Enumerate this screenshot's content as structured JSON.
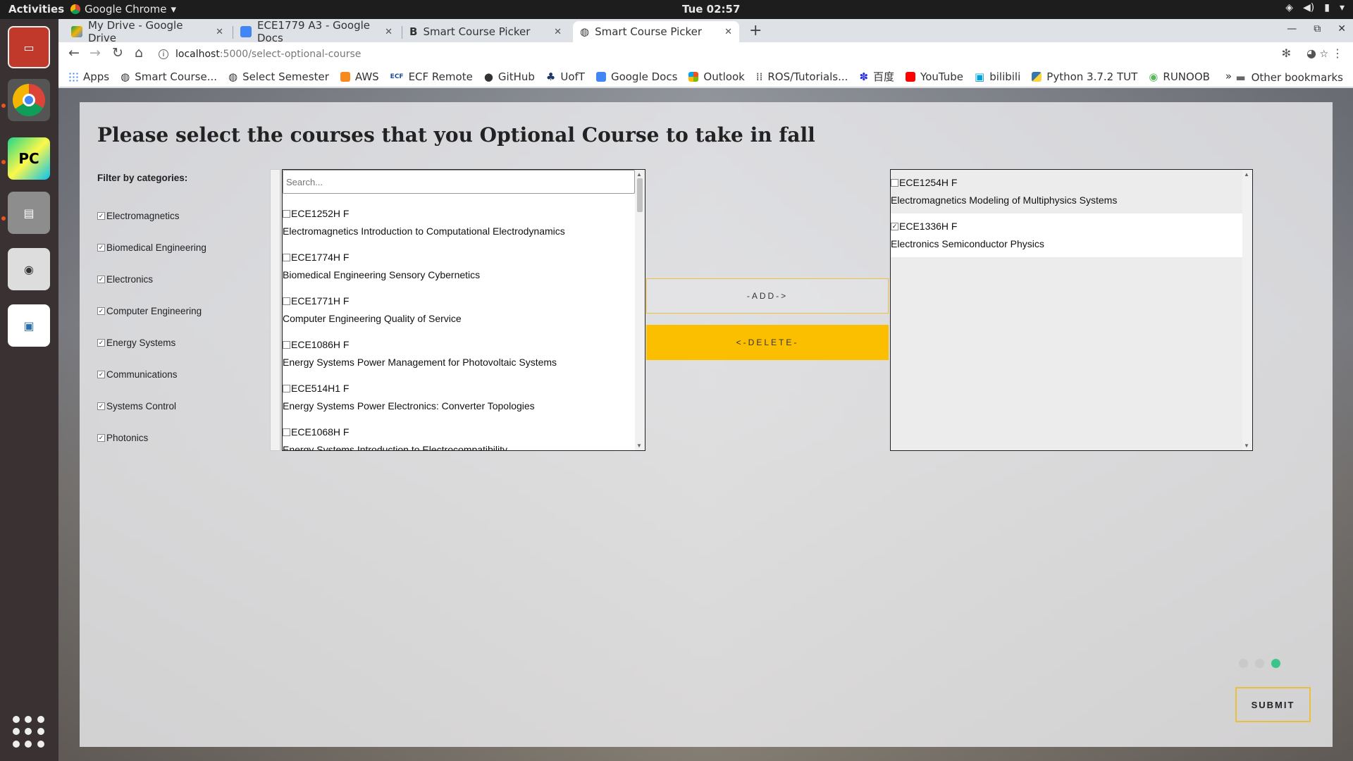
{
  "system": {
    "activities": "Activities",
    "app_name": "Google Chrome",
    "clock": "Tue 02:57"
  },
  "tabs": [
    {
      "title": "My Drive - Google Drive",
      "icon": "google-drive-icon",
      "active": false
    },
    {
      "title": "ECE1779 A3 - Google Docs",
      "icon": "google-docs-icon",
      "active": false
    },
    {
      "title": "Smart Course Picker",
      "icon": "bold-b-icon",
      "active": false
    },
    {
      "title": "Smart Course Picker",
      "icon": "globe-icon",
      "active": true
    }
  ],
  "omnibox": {
    "host": "localhost",
    "path": ":5000/select-optional-course"
  },
  "bookmarks": {
    "items": [
      "Apps",
      "Smart Course...",
      "Select Semester",
      "AWS",
      "ECF Remote",
      "GitHub",
      "UofT",
      "Google Docs",
      "Outlook",
      "ROS/Tutorials...",
      "百度",
      "YouTube",
      "bilibili",
      "Python 3.7.2 TUT",
      "RUNOOB"
    ],
    "more": "»",
    "other": "Other bookmarks"
  },
  "page": {
    "title": "Please select the courses that you Optional Course to take in fall",
    "filter_label": "Filter by categories:",
    "categories": [
      {
        "label": "Electromagnetics",
        "checked": true
      },
      {
        "label": "Biomedical Engineering",
        "checked": true
      },
      {
        "label": "Electronics",
        "checked": true
      },
      {
        "label": "Computer Engineering",
        "checked": true
      },
      {
        "label": "Energy Systems",
        "checked": true
      },
      {
        "label": "Communications",
        "checked": true
      },
      {
        "label": "Systems Control",
        "checked": true
      },
      {
        "label": "Photonics",
        "checked": true
      }
    ],
    "search_placeholder": "Search...",
    "available": [
      {
        "code": "ECE1252H F",
        "title": "Electromagnetics Introduction to Computational Electrodynamics"
      },
      {
        "code": "ECE1774H F",
        "title": "Biomedical Engineering Sensory Cybernetics"
      },
      {
        "code": "ECE1771H F",
        "title": "Computer Engineering Quality of Service"
      },
      {
        "code": "ECE1086H F",
        "title": "Energy Systems Power Management for Photovoltaic Systems"
      },
      {
        "code": "ECE514H1 F",
        "title": "Energy Systems Power Electronics: Converter Topologies"
      },
      {
        "code": "ECE1068H F",
        "title": "Energy Systems Introduction to Electrocompatibility"
      }
    ],
    "selected": [
      {
        "code": "ECE1254H F",
        "title": "Electromagnetics Modeling of Multiphysics Systems",
        "checked": false
      },
      {
        "code": "ECE1336H F",
        "title": "Electronics Semiconductor Physics",
        "checked": true
      }
    ],
    "add_label": "-ADD->",
    "delete_label": "<-DELETE-",
    "submit_label": "SUBMIT",
    "accent_color": "#fcbf00",
    "active_dot_color": "#3cc48a"
  }
}
